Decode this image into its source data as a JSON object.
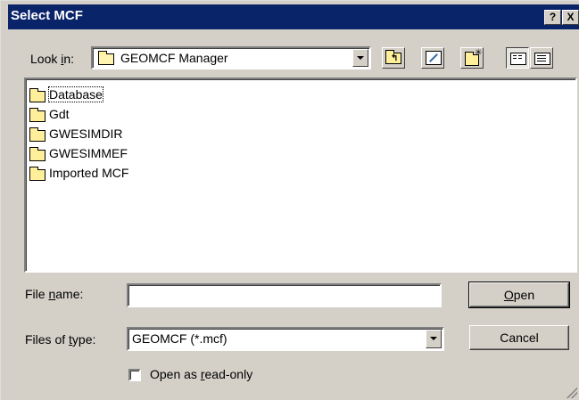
{
  "window": {
    "title": "Select MCF",
    "help_label": "?",
    "close_label": "X"
  },
  "lookin": {
    "label_pre": "Look ",
    "label_acc": "i",
    "label_post": "n:",
    "value": "GEOMCF Manager"
  },
  "toolbar": {
    "up_icon": "up-one-level-icon",
    "desktop_icon": "desktop-icon",
    "newfolder_icon": "new-folder-icon",
    "list_icon": "list-view-icon",
    "details_icon": "details-view-icon"
  },
  "files": [
    {
      "name": "Database"
    },
    {
      "name": "Gdt"
    },
    {
      "name": "GWESIMDIR"
    },
    {
      "name": "GWESIMMEF"
    },
    {
      "name": "Imported MCF"
    }
  ],
  "filename": {
    "label_pre": "File ",
    "label_acc": "n",
    "label_post": "ame:",
    "value": ""
  },
  "filetype": {
    "label_pre": "Files of ",
    "label_acc": "t",
    "label_post": "ype:",
    "value": "GEOMCF (*.mcf)"
  },
  "buttons": {
    "open_acc": "O",
    "open_rest": "pen",
    "cancel": "Cancel"
  },
  "readonly": {
    "label_pre": "Open as ",
    "label_acc": "r",
    "label_post": "ead-only"
  }
}
